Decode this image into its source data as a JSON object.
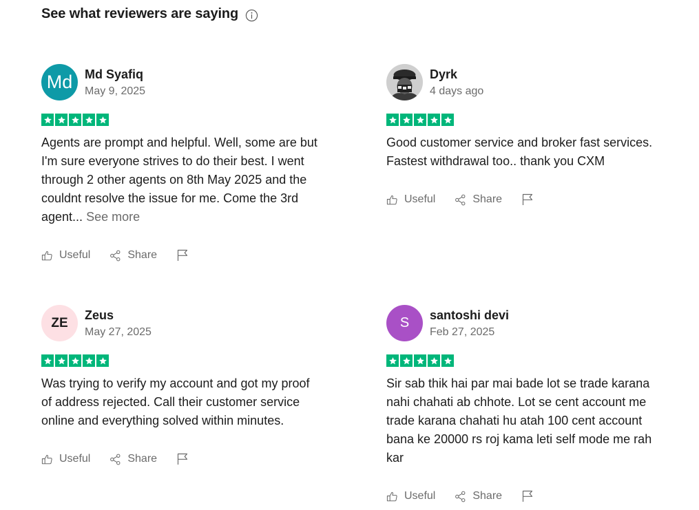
{
  "section": {
    "title": "See what reviewers are saying",
    "info_icon": "info-circle-icon"
  },
  "colors": {
    "star_green": "#00b67a",
    "text": "#1c1c1c",
    "muted": "#6b6b6b",
    "avatar_md": "#0e9aa7",
    "avatar_ze": "#fde0e4",
    "avatar_s": "#a950c6"
  },
  "reviews": [
    {
      "name": "Md Syafiq",
      "date": "May 9, 2025",
      "avatar_initials": "Md",
      "rating": 5,
      "text": "Agents are prompt and helpful. Well, some are but I'm sure everyone strives to do their best. I went through 2 other agents on 8th May 2025 and the couldnt resolve the issue for me. Come the 3rd agent...",
      "see_more": "See more",
      "useful_label": "Useful",
      "share_label": "Share"
    },
    {
      "name": "Dyrk",
      "date": "4 days ago",
      "avatar_initials": "",
      "rating": 5,
      "text": "Good customer service and broker fast services. Fastest withdrawal too.. thank you CXM",
      "useful_label": "Useful",
      "share_label": "Share"
    },
    {
      "name": "Zeus",
      "date": "May 27, 2025",
      "avatar_initials": "ZE",
      "rating": 5,
      "text": "Was trying to verify my account and got my proof of address rejected. Call their customer service online and everything solved within minutes.",
      "useful_label": "Useful",
      "share_label": "Share"
    },
    {
      "name": "santoshi devi",
      "date": "Feb 27, 2025",
      "avatar_initials": "S",
      "rating": 5,
      "text": "Sir sab thik hai par mai bade lot se trade karana nahi chahati ab chhote. Lot se cent account me trade karana chahati hu atah 100 cent account bana ke 20000 rs roj kama leti self mode me rah kar",
      "useful_label": "Useful",
      "share_label": "Share"
    }
  ]
}
